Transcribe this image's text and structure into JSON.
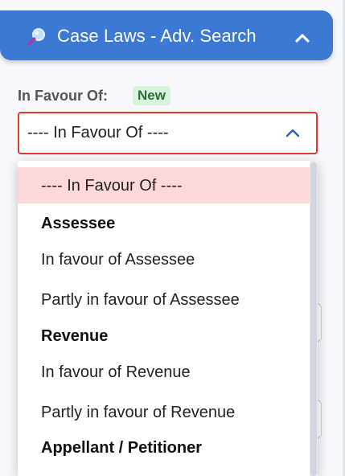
{
  "header": {
    "title": "Case Laws - Adv. Search",
    "icon": "search-icon",
    "collapse_icon": "chevron-up-icon",
    "color": "#3b79d4"
  },
  "filter": {
    "label": "In Favour Of:",
    "badge": "New",
    "selected_value": "---- In Favour Of ----",
    "chevron_icon": "chevron-up-icon",
    "border_color": "#e03a2f"
  },
  "dropdown": {
    "options": [
      {
        "label": "---- In Favour Of ----",
        "type": "option",
        "selected": true
      },
      {
        "label": "Assessee",
        "type": "group"
      },
      {
        "label": "In favour of Assessee",
        "type": "option"
      },
      {
        "label": "Partly in favour of Assessee",
        "type": "option"
      },
      {
        "label": "Revenue",
        "type": "group"
      },
      {
        "label": "In favour of Revenue",
        "type": "option"
      },
      {
        "label": "Partly in favour of Revenue",
        "type": "option"
      },
      {
        "label": "Appellant / Petitioner",
        "type": "group"
      }
    ]
  }
}
